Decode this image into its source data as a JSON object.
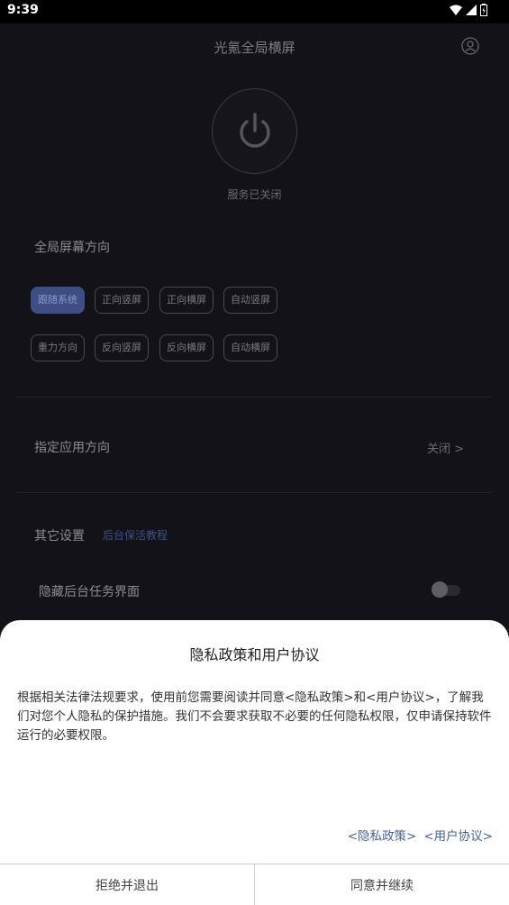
{
  "status_bar": {
    "time": "9:39"
  },
  "app": {
    "title": "光氪全局横屏",
    "service_status": "服务已关闭",
    "orientation_section": {
      "title": "全局屏幕方向",
      "options_row1": [
        "跟随系统",
        "正向竖屏",
        "正向横屏",
        "自动竖屏"
      ],
      "options_row2": [
        "重力方向",
        "反向竖屏",
        "反向横屏",
        "自动横屏"
      ],
      "selected": "跟随系统"
    },
    "app_orientation": {
      "label": "指定应用方向",
      "value": "关闭 >"
    },
    "other_settings": {
      "label": "其它设置",
      "link": "后台保活教程"
    },
    "hide_task": {
      "label": "隐藏后台任务界面",
      "enabled": false
    }
  },
  "dialog": {
    "title": "隐私政策和用户协议",
    "body": "根据相关法律法规要求，使用前您需要阅读并同意<隐私政策>和<用户协议>，了解我们对您个人隐私的保护措施。我们不会要求获取不必要的任何隐私权限，仅申请保持软件运行的必要权限。",
    "privacy_link": "<隐私政策>",
    "user_link": "<用户协议>",
    "decline_label": "拒绝并退出",
    "accept_label": "同意并继续"
  },
  "colors": {
    "accent": "#3d4e87",
    "link": "#4a6290",
    "background": "#121218"
  }
}
